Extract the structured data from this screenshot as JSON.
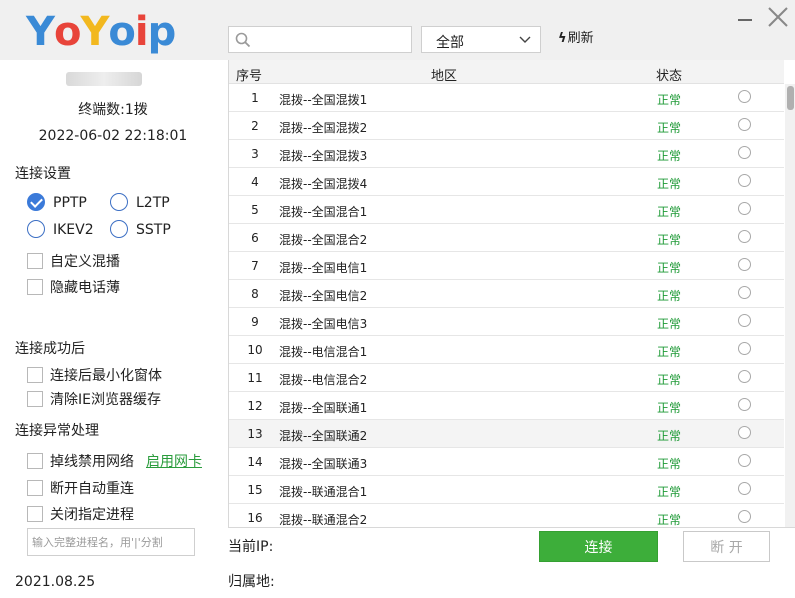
{
  "app": {
    "logo_text": "YoYoip",
    "logo_colors": [
      "#3a8ad6",
      "#e8443a",
      "#f2b81f",
      "#3a8ad6",
      "#e8443a",
      "#3a8ad6"
    ]
  },
  "toolbar": {
    "search_value": "",
    "filter_selected": "全部",
    "refresh_label": "刷新",
    "refresh_icon": "ϟ"
  },
  "sidebar": {
    "terminal_count": "终端数:1拨",
    "datetime": "2022-06-02 22:18:01",
    "connection_settings": {
      "title": "连接设置",
      "protocols": [
        {
          "label": "PPTP",
          "checked": true
        },
        {
          "label": "L2TP",
          "checked": false
        },
        {
          "label": "IKEV2",
          "checked": false
        },
        {
          "label": "SSTP",
          "checked": false
        }
      ],
      "custom_mix": "自定义混播",
      "hide_phonebook": "隐藏电话薄"
    },
    "after_connect": {
      "title": "连接成功后",
      "minimize": "连接后最小化窗体",
      "clear_ie_cache": "清除IE浏览器缓存"
    },
    "error_handling": {
      "title": "连接异常处理",
      "disable_network": "掉线禁用网络",
      "enable_nic_link": "启用网卡",
      "auto_reconnect": "断开自动重连",
      "close_process": "关闭指定进程",
      "process_placeholder": "输入完整进程名，用'|'分割"
    },
    "version": "2021.08.25"
  },
  "table": {
    "headers": {
      "no": "序号",
      "area": "地区",
      "status": "状态"
    },
    "rows": [
      {
        "no": "1",
        "area": "混拨--全国混拨1",
        "status": "正常"
      },
      {
        "no": "2",
        "area": "混拨--全国混拨2",
        "status": "正常"
      },
      {
        "no": "3",
        "area": "混拨--全国混拨3",
        "status": "正常"
      },
      {
        "no": "4",
        "area": "混拨--全国混拨4",
        "status": "正常"
      },
      {
        "no": "5",
        "area": "混拨--全国混合1",
        "status": "正常"
      },
      {
        "no": "6",
        "area": "混拨--全国混合2",
        "status": "正常"
      },
      {
        "no": "7",
        "area": "混拨--全国电信1",
        "status": "正常"
      },
      {
        "no": "8",
        "area": "混拨--全国电信2",
        "status": "正常"
      },
      {
        "no": "9",
        "area": "混拨--全国电信3",
        "status": "正常"
      },
      {
        "no": "10",
        "area": "混拨--电信混合1",
        "status": "正常"
      },
      {
        "no": "11",
        "area": "混拨--电信混合2",
        "status": "正常"
      },
      {
        "no": "12",
        "area": "混拨--全国联通1",
        "status": "正常"
      },
      {
        "no": "13",
        "area": "混拨--全国联通2",
        "status": "正常",
        "selected": true
      },
      {
        "no": "14",
        "area": "混拨--全国联通3",
        "status": "正常"
      },
      {
        "no": "15",
        "area": "混拨--联通混合1",
        "status": "正常"
      },
      {
        "no": "16",
        "area": "混拨--联通混合2",
        "status": "正常"
      }
    ]
  },
  "footer": {
    "current_ip_label": "当前IP:",
    "location_label": "归属地:",
    "connect_label": "连接",
    "disconnect_label": "断 开"
  },
  "colors": {
    "status_ok": "#1e9a36",
    "connect_button": "#3dae3a",
    "link": "#2a9c3c",
    "radio_checked": "#3b7ad9"
  }
}
